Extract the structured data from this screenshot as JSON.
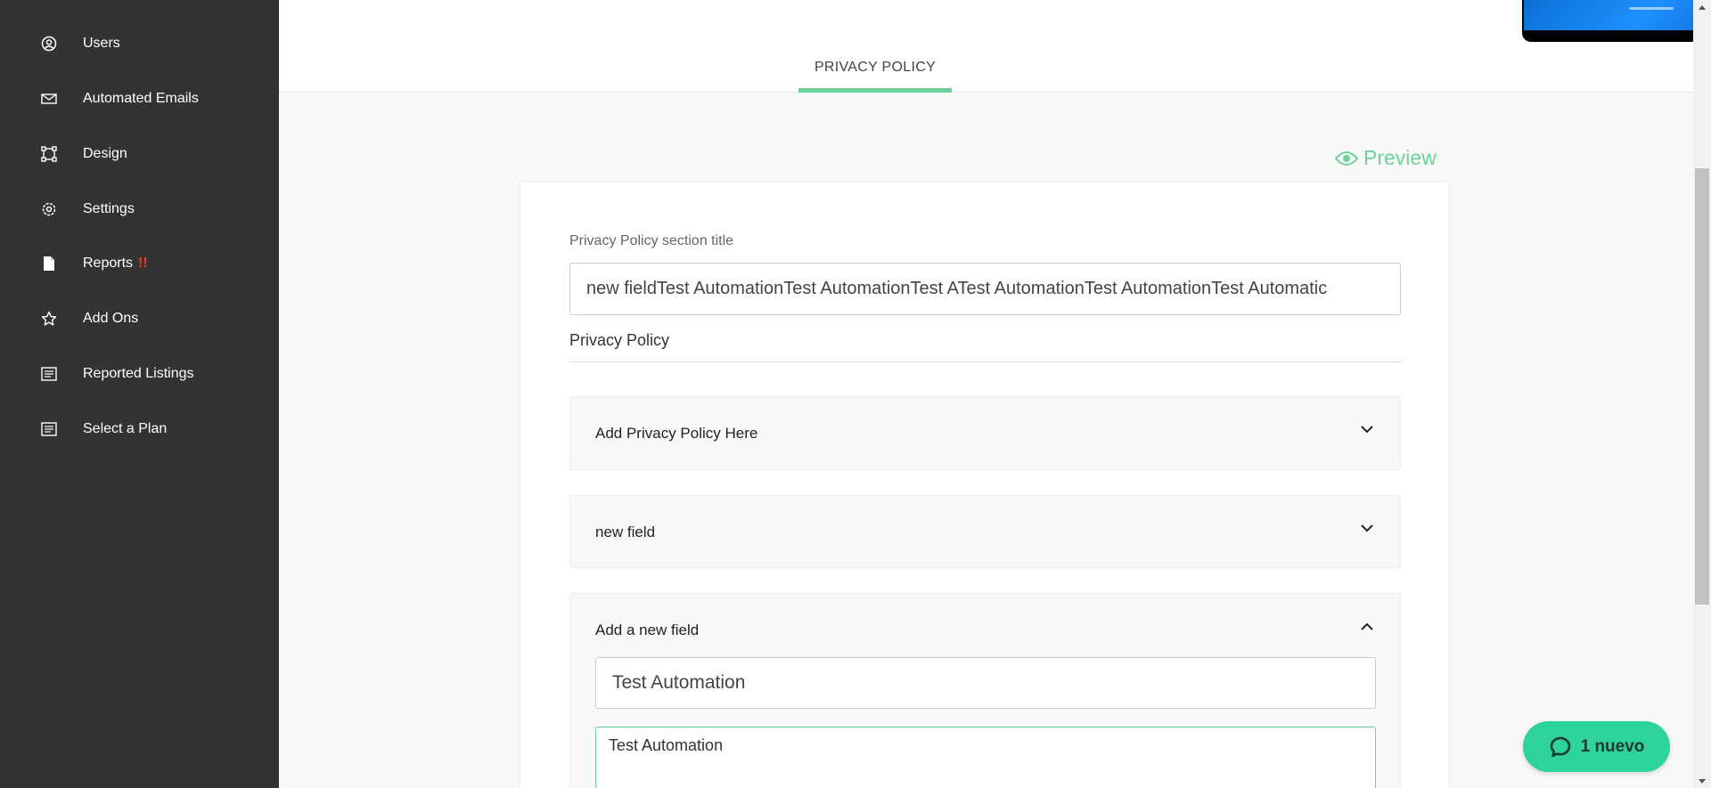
{
  "sidebar": {
    "items": [
      {
        "label": "Users",
        "icon": "user-circle-icon"
      },
      {
        "label": "Automated Emails",
        "icon": "envelope-icon"
      },
      {
        "label": "Design",
        "icon": "vector-square-icon"
      },
      {
        "label": "Settings",
        "icon": "gear-icon"
      },
      {
        "label": "Reports",
        "icon": "file-icon",
        "badge": "!!"
      },
      {
        "label": "Add Ons",
        "icon": "star-icon"
      },
      {
        "label": "Reported Listings",
        "icon": "list-document-icon"
      },
      {
        "label": "Select a Plan",
        "icon": "list-document-icon"
      }
    ]
  },
  "header": {
    "tab_label": "PRIVACY POLICY"
  },
  "preview": {
    "label": "Preview"
  },
  "form": {
    "title_label": "Privacy Policy section title",
    "title_value": "new fieldTest AutomationTest AutomationTest ATest AutomationTest AutomationTest Automatic",
    "section_heading": "Privacy Policy",
    "accordions": [
      {
        "title": "Add Privacy Policy Here",
        "state": "collapsed"
      },
      {
        "title": "new field",
        "state": "collapsed"
      },
      {
        "title": "Add a new field",
        "state": "expanded"
      }
    ],
    "new_field_title_value": "Test Automation",
    "new_field_body_value": "Test Automation"
  },
  "chat": {
    "label": "1 nuevo"
  },
  "colors": {
    "accent": "#6cd19b",
    "sidebar_bg": "#333333",
    "chat_bg": "#2ed39b",
    "badge": "#e53935"
  }
}
